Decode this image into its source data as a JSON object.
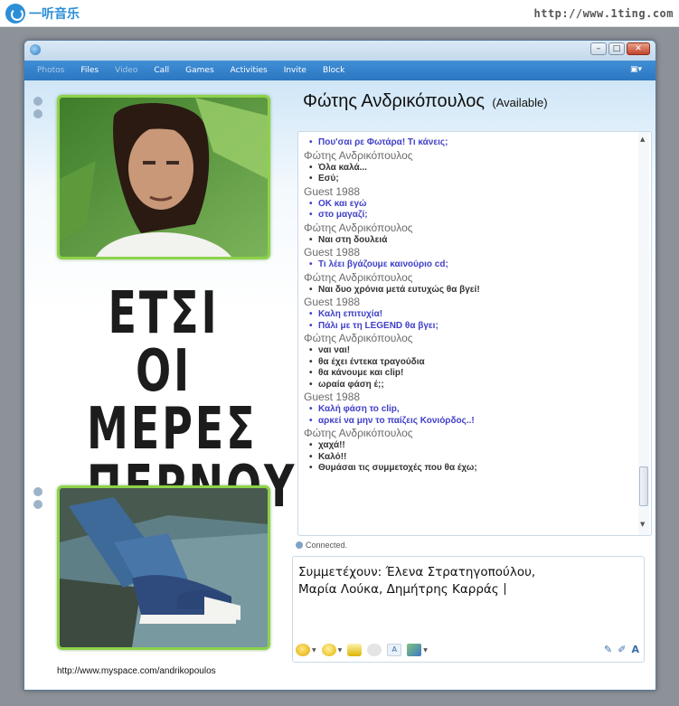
{
  "banner": {
    "logo_text": "一听音乐",
    "url": "http://www.1ting.com"
  },
  "menu": {
    "items": [
      {
        "label": "Photos",
        "enabled": false
      },
      {
        "label": "Files",
        "enabled": true
      },
      {
        "label": "Video",
        "enabled": false
      },
      {
        "label": "Call",
        "enabled": true
      },
      {
        "label": "Games",
        "enabled": true
      },
      {
        "label": "Activities",
        "enabled": true
      },
      {
        "label": "Invite",
        "enabled": true
      },
      {
        "label": "Block",
        "enabled": true
      }
    ]
  },
  "contact": {
    "name": "Φώτης Ανδρικόπουλος",
    "status": "(Available)"
  },
  "poster": {
    "lines": [
      "ΕΤΣΙ ΟΙ",
      "ΜΕΡΕΣ",
      "ΠΕΡΝΟΥΝ"
    ]
  },
  "conversation": [
    {
      "sender": "",
      "type": "guest",
      "messages": [
        "Που'σαι ρε Φωτάρα! Τι κάνεις;"
      ]
    },
    {
      "sender": "Φώτης Ανδρικόπουλος",
      "type": "contact",
      "messages": [
        "Όλα καλά...",
        "Εσύ;"
      ]
    },
    {
      "sender": "Guest 1988",
      "type": "guest",
      "messages": [
        "ΟΚ και εγώ",
        "στο μαγαζί;"
      ]
    },
    {
      "sender": "Φώτης Ανδρικόπουλος",
      "type": "contact",
      "messages": [
        "Ναι στη δουλειά"
      ]
    },
    {
      "sender": "Guest 1988",
      "type": "guest",
      "messages": [
        "Τι λέει βγάζουμε καινούριο cd;"
      ]
    },
    {
      "sender": "Φώτης Ανδρικόπουλος",
      "type": "contact",
      "messages": [
        "Ναι δυο χρόνια μετά ευτυχώς θα βγεί!"
      ]
    },
    {
      "sender": "Guest 1988",
      "type": "guest",
      "messages": [
        "Καλη επιτυχία!",
        "Πάλι με τη LEGEND θα βγει;"
      ]
    },
    {
      "sender": "Φώτης Ανδρικόπουλος",
      "type": "contact",
      "messages": [
        "ναι ναι!",
        "θα έχει έντεκα τραγούδια",
        "θα κάνουμε και clip!",
        "ωραία φάση έ;;"
      ]
    },
    {
      "sender": "Guest 1988",
      "type": "guest",
      "messages": [
        "Καλή φάση το clip,",
        "αρκεί να μην το παίζεις Κονιόρδος..!"
      ]
    },
    {
      "sender": "Φώτης Ανδρικόπουλος",
      "type": "contact",
      "messages": [
        "χαχά!!",
        "Καλό!!",
        "Θυμάσαι τις συμμετοχές που θα έχω;"
      ]
    }
  ],
  "status_bar": {
    "connected": "Connected."
  },
  "compose": {
    "line1": "Συμμετέχουν: Έλενα Στρατηγοπούλου,",
    "line2": "Μαρία Λούκα, Δημήτρης Καρράς"
  },
  "footer": {
    "link": "http://www.myspace.com/andrikopoulos"
  },
  "colors": {
    "guest_text": "#4040c8",
    "contact_text": "#333333",
    "frame_green": "#8dd24a",
    "menubar_blue": "#2c76c1"
  }
}
